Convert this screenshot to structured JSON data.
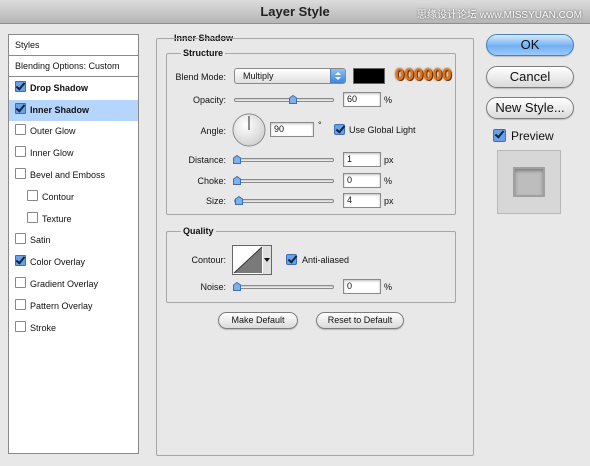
{
  "window": {
    "title": "Layer Style",
    "watermark": "思缘设计论坛 www.MISSYUAN.COM"
  },
  "styles_list": {
    "header": "Styles",
    "items": [
      {
        "label": "Blending Options: Custom",
        "checkbox": false,
        "checked": false,
        "selected": false,
        "indent": false,
        "bold": false
      },
      {
        "label": "Drop Shadow",
        "checkbox": true,
        "checked": true,
        "selected": false,
        "indent": false,
        "bold": true
      },
      {
        "label": "Inner Shadow",
        "checkbox": true,
        "checked": true,
        "selected": true,
        "indent": false,
        "bold": true
      },
      {
        "label": "Outer Glow",
        "checkbox": true,
        "checked": false,
        "selected": false,
        "indent": false,
        "bold": false
      },
      {
        "label": "Inner Glow",
        "checkbox": true,
        "checked": false,
        "selected": false,
        "indent": false,
        "bold": false
      },
      {
        "label": "Bevel and Emboss",
        "checkbox": true,
        "checked": false,
        "selected": false,
        "indent": false,
        "bold": false
      },
      {
        "label": "Contour",
        "checkbox": true,
        "checked": false,
        "selected": false,
        "indent": true,
        "bold": false
      },
      {
        "label": "Texture",
        "checkbox": true,
        "checked": false,
        "selected": false,
        "indent": true,
        "bold": false
      },
      {
        "label": "Satin",
        "checkbox": true,
        "checked": false,
        "selected": false,
        "indent": false,
        "bold": false
      },
      {
        "label": "Color Overlay",
        "checkbox": true,
        "checked": true,
        "selected": false,
        "indent": false,
        "bold": false
      },
      {
        "label": "Gradient Overlay",
        "checkbox": true,
        "checked": false,
        "selected": false,
        "indent": false,
        "bold": false
      },
      {
        "label": "Pattern Overlay",
        "checkbox": true,
        "checked": false,
        "selected": false,
        "indent": false,
        "bold": false
      },
      {
        "label": "Stroke",
        "checkbox": true,
        "checked": false,
        "selected": false,
        "indent": false,
        "bold": false
      }
    ]
  },
  "panel": {
    "title": "Inner Shadow",
    "structure": {
      "title": "Structure",
      "blend_mode_label": "Blend Mode:",
      "blend_mode_value": "Multiply",
      "shadow_color": "#000000",
      "color_annotation": "000000",
      "opacity_label": "Opacity:",
      "opacity_value": "60",
      "opacity_unit": "%",
      "opacity_level": 0.6,
      "angle_label": "Angle:",
      "angle_value": "90",
      "angle_unit": "°",
      "angle_degrees": 90,
      "global_light_label": "Use Global Light",
      "global_light_checked": true,
      "distance_label": "Distance:",
      "distance_value": "1",
      "distance_unit": "px",
      "distance_level": 0.0,
      "choke_label": "Choke:",
      "choke_value": "0",
      "choke_unit": "%",
      "choke_level": 0.0,
      "size_label": "Size:",
      "size_value": "4",
      "size_unit": "px",
      "size_level": 0.02
    },
    "quality": {
      "title": "Quality",
      "contour_label": "Contour:",
      "anti_aliased_label": "Anti-aliased",
      "anti_aliased_checked": true,
      "noise_label": "Noise:",
      "noise_value": "0",
      "noise_unit": "%",
      "noise_level": 0.0
    },
    "make_default_label": "Make Default",
    "reset_default_label": "Reset to Default"
  },
  "buttons": {
    "ok_label": "OK",
    "cancel_label": "Cancel",
    "new_style_label": "New Style...",
    "preview_label": "Preview",
    "preview_checked": true
  },
  "colors": {
    "accent": "#6aa0e8",
    "selected_row": "#b5d5ff",
    "annotation": "#e8720c"
  }
}
